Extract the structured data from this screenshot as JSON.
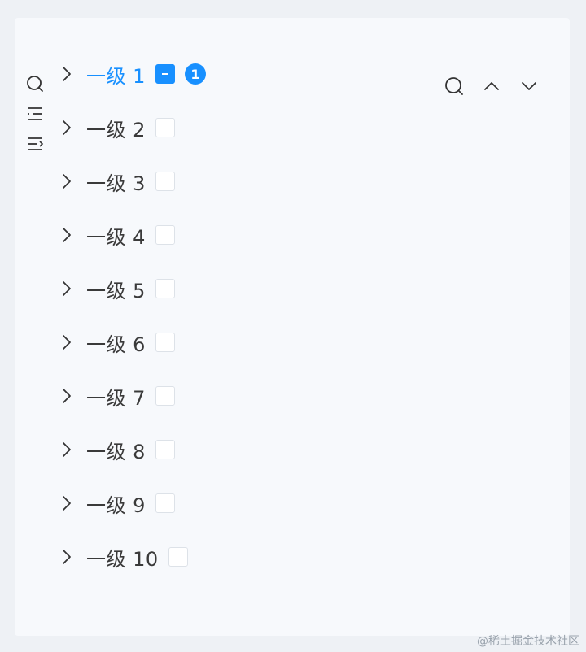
{
  "tree": {
    "nodes": [
      {
        "label": "一级 1",
        "state": "indeterminate",
        "badge": "1",
        "active": true
      },
      {
        "label": "一级 2",
        "state": "unchecked"
      },
      {
        "label": "一级 3",
        "state": "unchecked"
      },
      {
        "label": "一级 4",
        "state": "unchecked"
      },
      {
        "label": "一级 5",
        "state": "unchecked"
      },
      {
        "label": "一级 6",
        "state": "unchecked"
      },
      {
        "label": "一级 7",
        "state": "unchecked"
      },
      {
        "label": "一级 8",
        "state": "unchecked"
      },
      {
        "label": "一级 9",
        "state": "unchecked"
      },
      {
        "label": "一级 10",
        "state": "unchecked"
      }
    ]
  },
  "left_toolbar": {
    "icons": [
      "search-icon",
      "list-indent-icon",
      "list-outdent-icon"
    ]
  },
  "right_toolbar": {
    "icons": [
      "search-icon",
      "chevron-up-icon",
      "chevron-down-icon"
    ]
  },
  "watermark": "@稀土掘金技术社区",
  "colors": {
    "accent": "#1890ff",
    "text": "#3a3a3a",
    "panel": "#f7f9fc",
    "background": "#eef1f5"
  }
}
